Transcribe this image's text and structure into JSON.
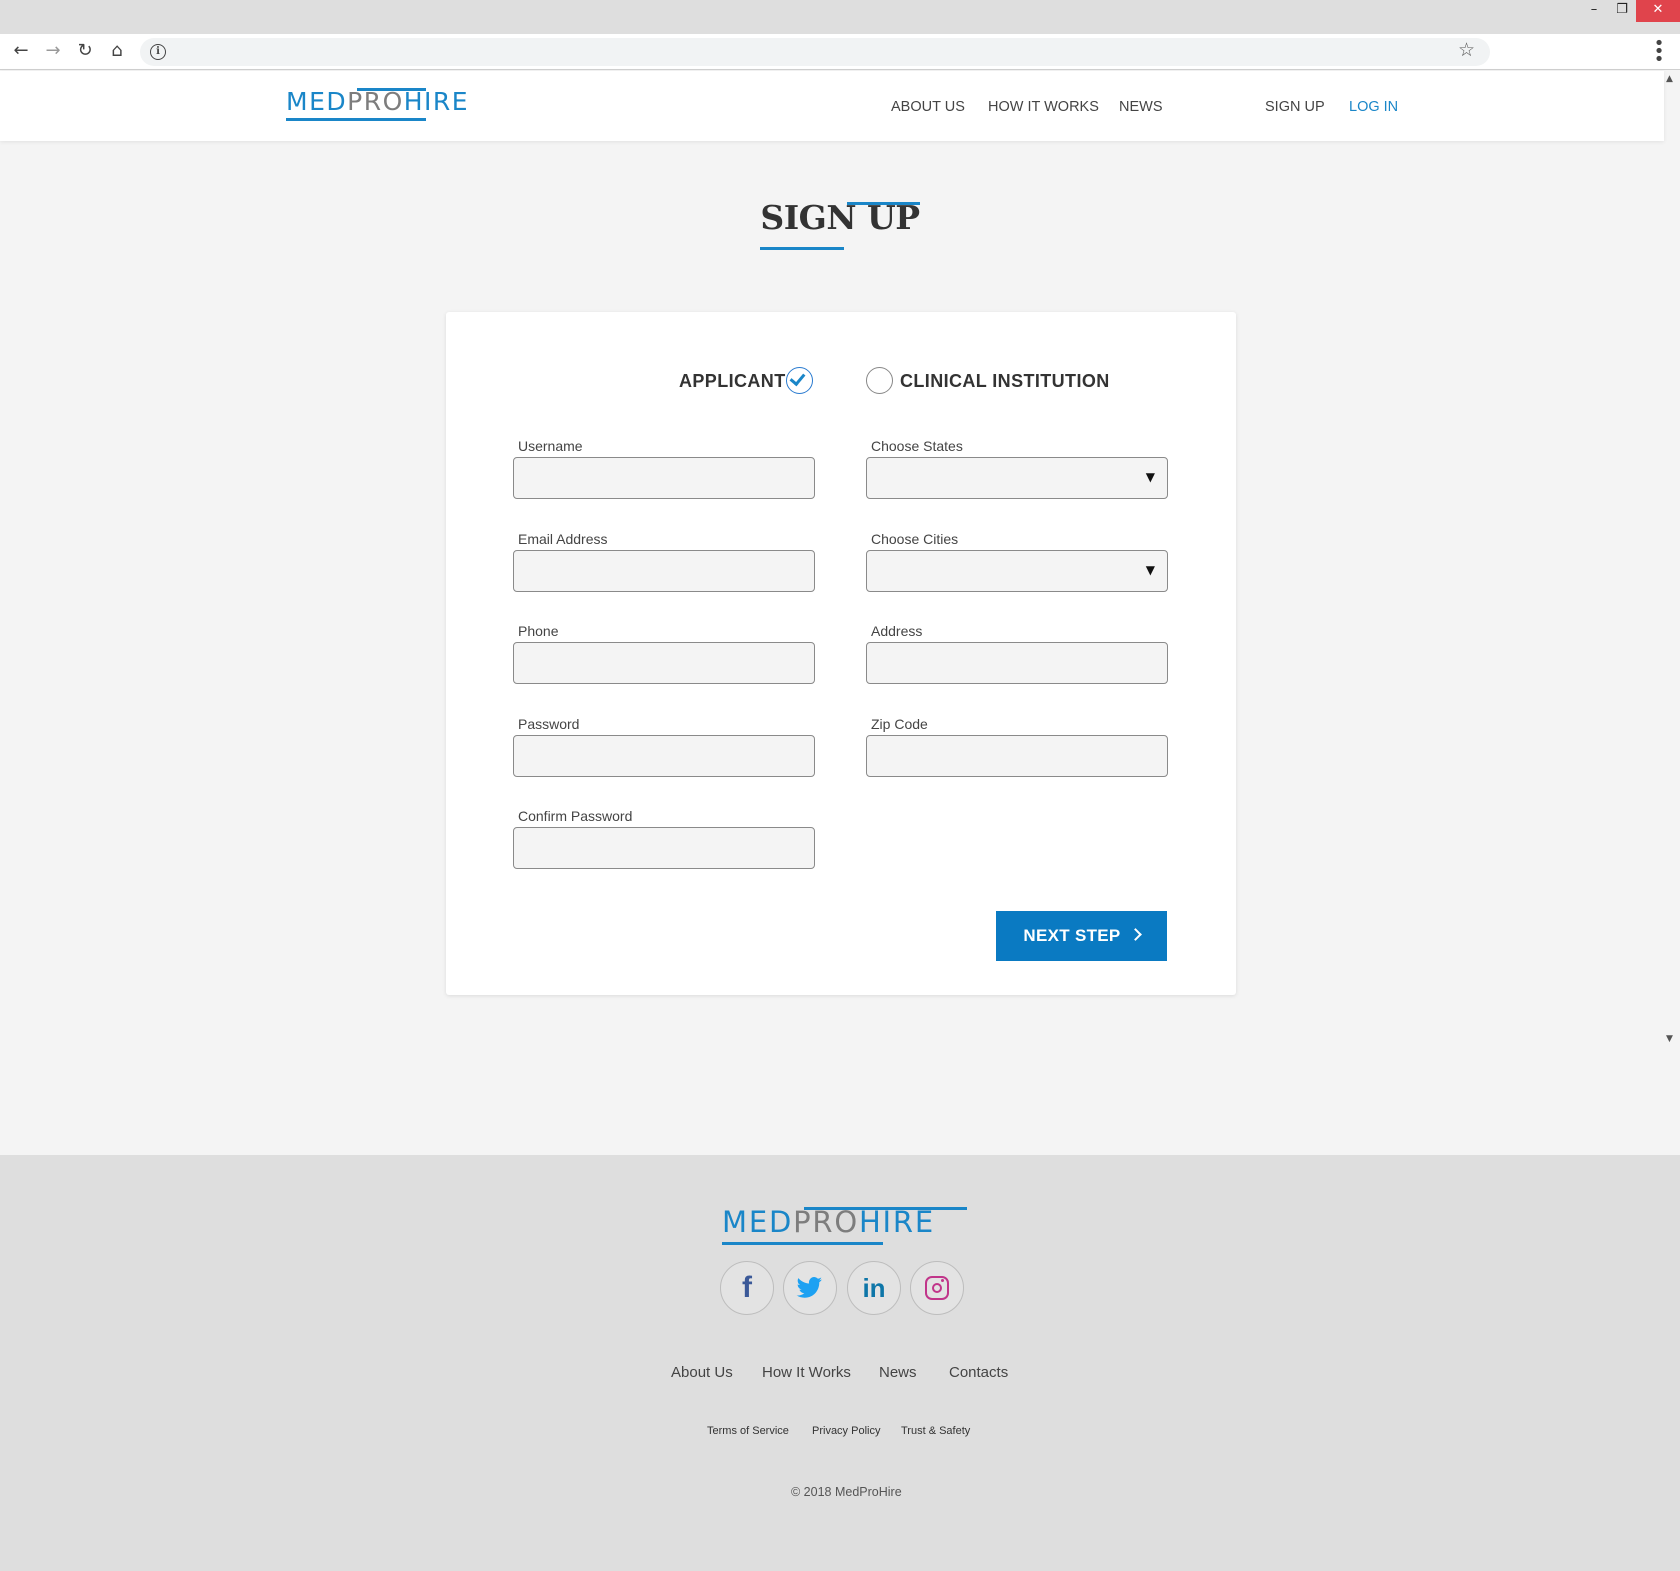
{
  "browser": {
    "window_controls": {
      "minimize": "–",
      "maximize": "❐",
      "close": "✕"
    },
    "nav": {
      "back_icon": "←",
      "forward_icon": "→",
      "reload_icon": "↻",
      "home_icon": "⌂"
    },
    "address": {
      "info_icon": "i",
      "url": ""
    },
    "star_icon": "☆",
    "menu_icon": "⋮"
  },
  "header": {
    "logo": {
      "part1": "MED",
      "part2": "PRO",
      "part3": "HIRE"
    },
    "nav": [
      "ABOUT US",
      "HOW IT WORKS",
      "NEWS"
    ],
    "auth": {
      "signup": "SIGN UP",
      "login": "LOG IN"
    }
  },
  "page": {
    "title": "SIGN UP"
  },
  "form": {
    "roles": {
      "applicant": {
        "label": "APPLICANT",
        "selected": true
      },
      "clinical": {
        "label": "CLINICAL INSTITUTION",
        "selected": false
      }
    },
    "left_fields": [
      {
        "label": "Username",
        "value": ""
      },
      {
        "label": "Email Address",
        "value": ""
      },
      {
        "label": "Phone",
        "value": ""
      },
      {
        "label": "Password",
        "value": ""
      },
      {
        "label": "Confirm Password",
        "value": ""
      }
    ],
    "right_fields": [
      {
        "label": "Choose States",
        "value": "",
        "type": "select"
      },
      {
        "label": "Choose Cities",
        "value": "",
        "type": "select"
      },
      {
        "label": "Address",
        "value": ""
      },
      {
        "label": "Zip Code",
        "value": ""
      }
    ],
    "select_caret": "▼",
    "next_button": "NEXT STEP"
  },
  "scrollbar": {
    "up": "▲",
    "down": "▼"
  },
  "footer": {
    "logo": {
      "part1": "MED",
      "part2": "PRO",
      "part3": "HIRE"
    },
    "social": {
      "facebook": "f",
      "twitter": "twitter-icon",
      "linkedin": "in",
      "instagram": "instagram-icon"
    },
    "links": [
      "About Us",
      "How It Works",
      "News",
      "Contacts"
    ],
    "legal": [
      "Terms of Service",
      "Privacy Policy",
      "Trust & Safety"
    ],
    "copyright": "© 2018 MedProHire"
  },
  "colors": {
    "brand_blue": "#1a86c8",
    "button_blue": "#0a7ac2",
    "logo_gray": "#7d7d7d",
    "footer_bg": "#dedede",
    "page_bg": "#f4f4f4"
  }
}
